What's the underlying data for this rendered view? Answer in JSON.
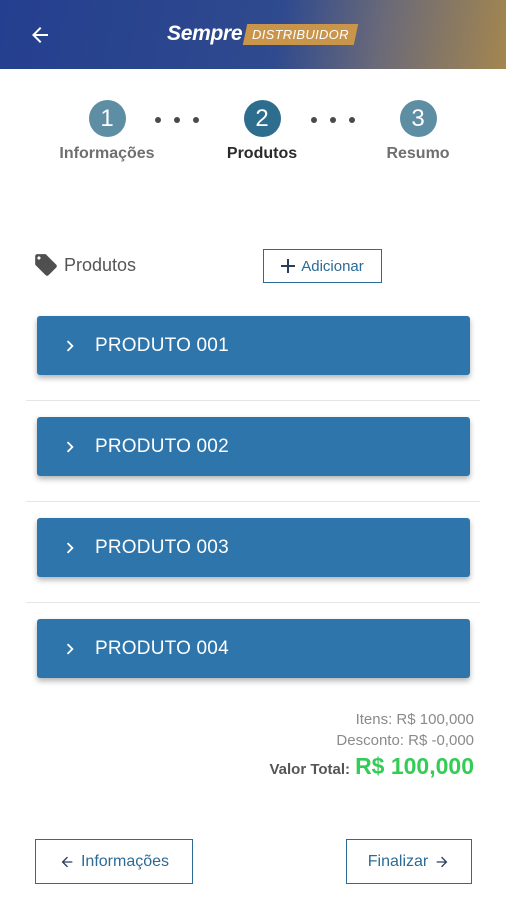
{
  "header": {
    "brand": "Sempre",
    "tag": "DISTRIBUIDOR",
    "back_icon": "arrow-left-icon",
    "colors": {
      "gradient_start": "#243f8f",
      "gradient_end": "#a4864f",
      "tag_bg": "#c9954a"
    }
  },
  "stepper": {
    "steps": [
      {
        "number": "1",
        "label": "Informações",
        "state": "done",
        "color": "#5e8ea4"
      },
      {
        "number": "2",
        "label": "Produtos",
        "state": "active",
        "color": "#2d6e8f"
      },
      {
        "number": "3",
        "label": "Resumo",
        "state": "pending",
        "color": "#5e8ea4"
      }
    ]
  },
  "section": {
    "title": "Produtos",
    "icon": "tag-icon",
    "add_label": "Adicionar"
  },
  "products": [
    {
      "label": "PRODUTO 001"
    },
    {
      "label": "PRODUTO 002"
    },
    {
      "label": "PRODUTO 003"
    },
    {
      "label": "PRODUTO 004"
    }
  ],
  "totals": {
    "items": "Itens: R$ 100,000",
    "discount": "Desconto: R$ -0,000",
    "total_label": "Valor Total:",
    "total_value": "R$ 100,000",
    "total_color": "#33cc55"
  },
  "footer": {
    "prev_label": "Informações",
    "next_label": "Finalizar"
  }
}
